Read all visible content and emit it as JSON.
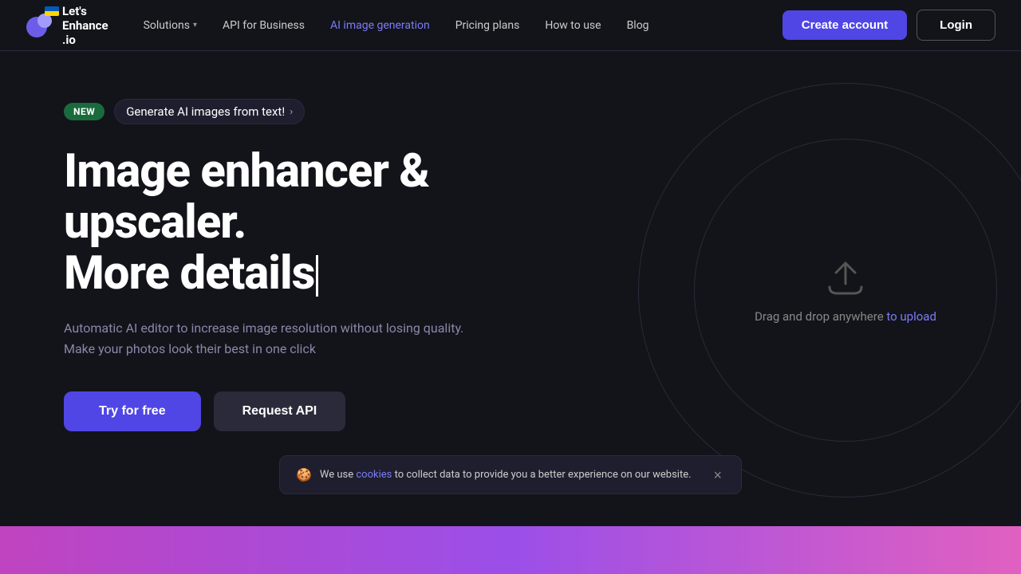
{
  "navbar": {
    "logo_text": "Let's\nEnhance\n.io",
    "logo_text_line1": "Let's",
    "logo_text_line2": "Enhance",
    "logo_text_line3": ".io",
    "nav_solutions": "Solutions",
    "nav_api": "API for Business",
    "nav_ai_image": "AI image generation",
    "nav_pricing": "Pricing plans",
    "nav_how": "How to use",
    "nav_blog": "Blog",
    "btn_create": "Create account",
    "btn_login": "Login"
  },
  "hero": {
    "new_label": "NEW",
    "new_text": "Generate AI images from text!",
    "title_line1": "Image enhancer & upscaler.",
    "title_line2": "More details",
    "subtitle_line1": "Automatic AI editor to increase image resolution without losing quality.",
    "subtitle_line2": "Make your photos look their best in one click",
    "btn_try": "Try for free",
    "btn_api": "Request API",
    "drag_text": "Drag and drop anywhere ",
    "drag_link": "to upload"
  },
  "cookie": {
    "text_before": "We use ",
    "link": "cookies",
    "text_after": " to collect data to provide you a better experience on our website.",
    "close": "×"
  }
}
